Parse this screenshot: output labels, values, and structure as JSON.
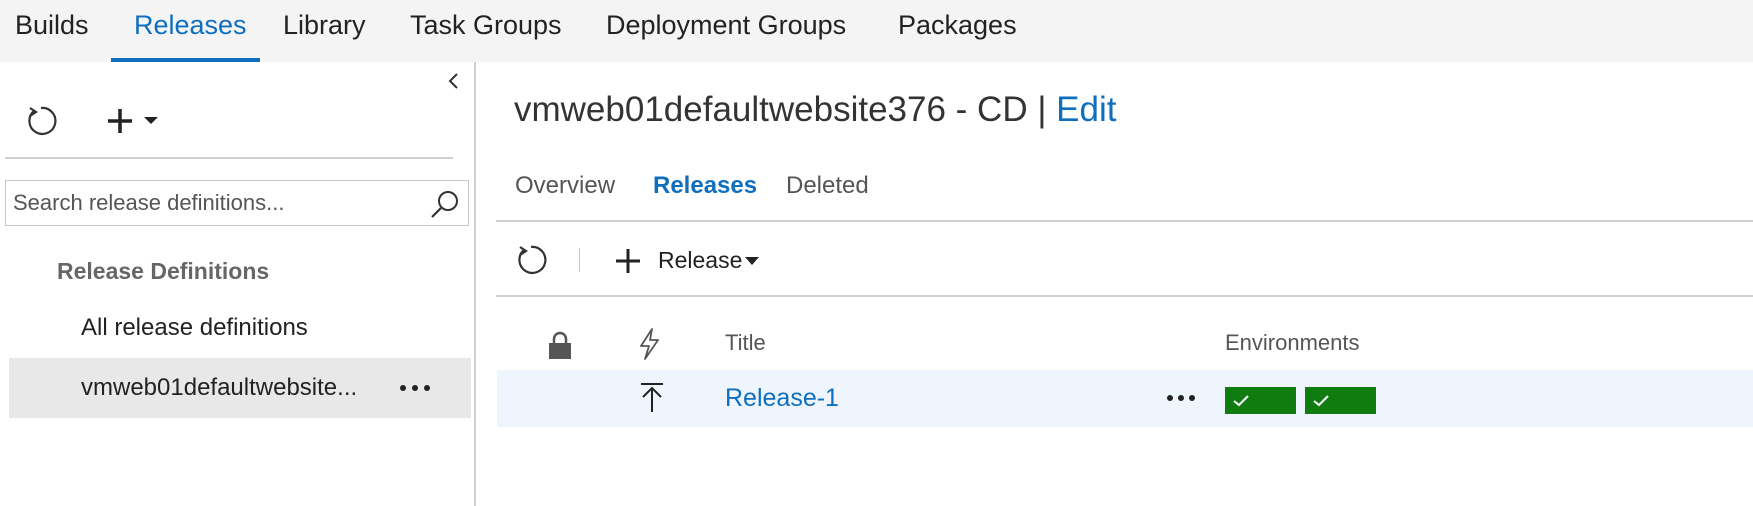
{
  "top_nav": {
    "tabs": [
      {
        "label": "Builds",
        "active": false
      },
      {
        "label": "Releases",
        "active": true
      },
      {
        "label": "Library",
        "active": false
      },
      {
        "label": "Task Groups",
        "active": false
      },
      {
        "label": "Deployment Groups",
        "active": false
      },
      {
        "label": "Packages",
        "active": false
      }
    ]
  },
  "sidebar": {
    "search_placeholder": "Search release definitions...",
    "section_heading": "Release Definitions",
    "items": [
      {
        "label": "All release definitions",
        "selected": false
      },
      {
        "label": "vmweb01defaultwebsite...",
        "selected": true
      }
    ]
  },
  "main": {
    "title": "vmweb01defaultwebsite376 - CD",
    "title_separator": "|",
    "edit_link": "Edit",
    "tabs": [
      {
        "label": "Overview",
        "active": false
      },
      {
        "label": "Releases",
        "active": true
      },
      {
        "label": "Deleted",
        "active": false
      }
    ],
    "toolbar": {
      "release_label": "Release"
    },
    "table": {
      "columns": {
        "title": "Title",
        "environments": "Environments"
      },
      "rows": [
        {
          "title": "Release-1",
          "environments": [
            "succeeded",
            "succeeded"
          ]
        }
      ]
    }
  },
  "colors": {
    "accent": "#106ebe",
    "success": "#107c10",
    "selected_row": "#eef5fc"
  },
  "icons": [
    "refresh-icon",
    "add-icon",
    "chevron-left-icon",
    "search-icon",
    "more-icon",
    "lock-icon",
    "lightning-icon",
    "deploy-arrow-icon",
    "check-icon",
    "caret-down-icon"
  ]
}
